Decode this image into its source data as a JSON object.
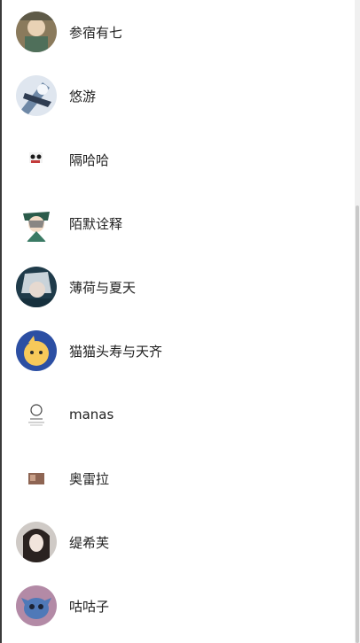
{
  "users": [
    {
      "name": "参宿有七",
      "avatar": "photo-avatar"
    },
    {
      "name": "悠游",
      "avatar": "anime-blue-avatar"
    },
    {
      "name": "隔哈哈",
      "avatar": "small-panda-avatar"
    },
    {
      "name": "陌默诠释",
      "avatar": "anime-venti-avatar"
    },
    {
      "name": "薄荷与夏天",
      "avatar": "anime-silver-hair-avatar"
    },
    {
      "name": "猫猫头寿与天齐",
      "avatar": "anime-blue-bg-avatar"
    },
    {
      "name": "manas",
      "avatar": "sketch-avatar"
    },
    {
      "name": "奥雷拉",
      "avatar": "tiny-photo-avatar"
    },
    {
      "name": "缇希芙",
      "avatar": "girl-photo-avatar"
    },
    {
      "name": "咕咕子",
      "avatar": "stitch-avatar"
    }
  ]
}
